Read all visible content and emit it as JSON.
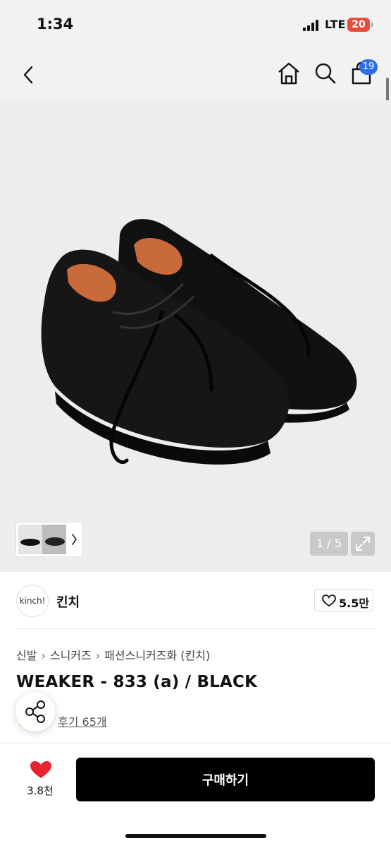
{
  "status_bar": {
    "time": "1:34",
    "network": "LTE",
    "battery": "20",
    "battery_color": "#e74c3c"
  },
  "nav": {
    "back_icon": "chevron-left-icon",
    "home_icon": "home-icon",
    "search_icon": "search-icon",
    "cart_icon": "shopping-bag-icon",
    "cart_badge": "19",
    "badge_color": "#2f6fe6"
  },
  "gallery": {
    "image_label": "black leather sneakers product photo",
    "counter": "1 / 5",
    "expand_icon": "expand-icon",
    "thumb_next_icon": "chevron-right-icon"
  },
  "store": {
    "logo_text": "kinch!",
    "name": "킨치",
    "likes": "5.5만"
  },
  "breadcrumb": [
    "신발",
    "스니커즈",
    "패션스니커즈화 (킨치)"
  ],
  "product": {
    "title": "WEAKER - 833 (a) / BLACK",
    "reviews": "후기 65개"
  },
  "bottom": {
    "wish_count": "3.8천",
    "buy_label": "구매하기",
    "wish_color": "#e8242f",
    "share_icon": "share-icon"
  }
}
